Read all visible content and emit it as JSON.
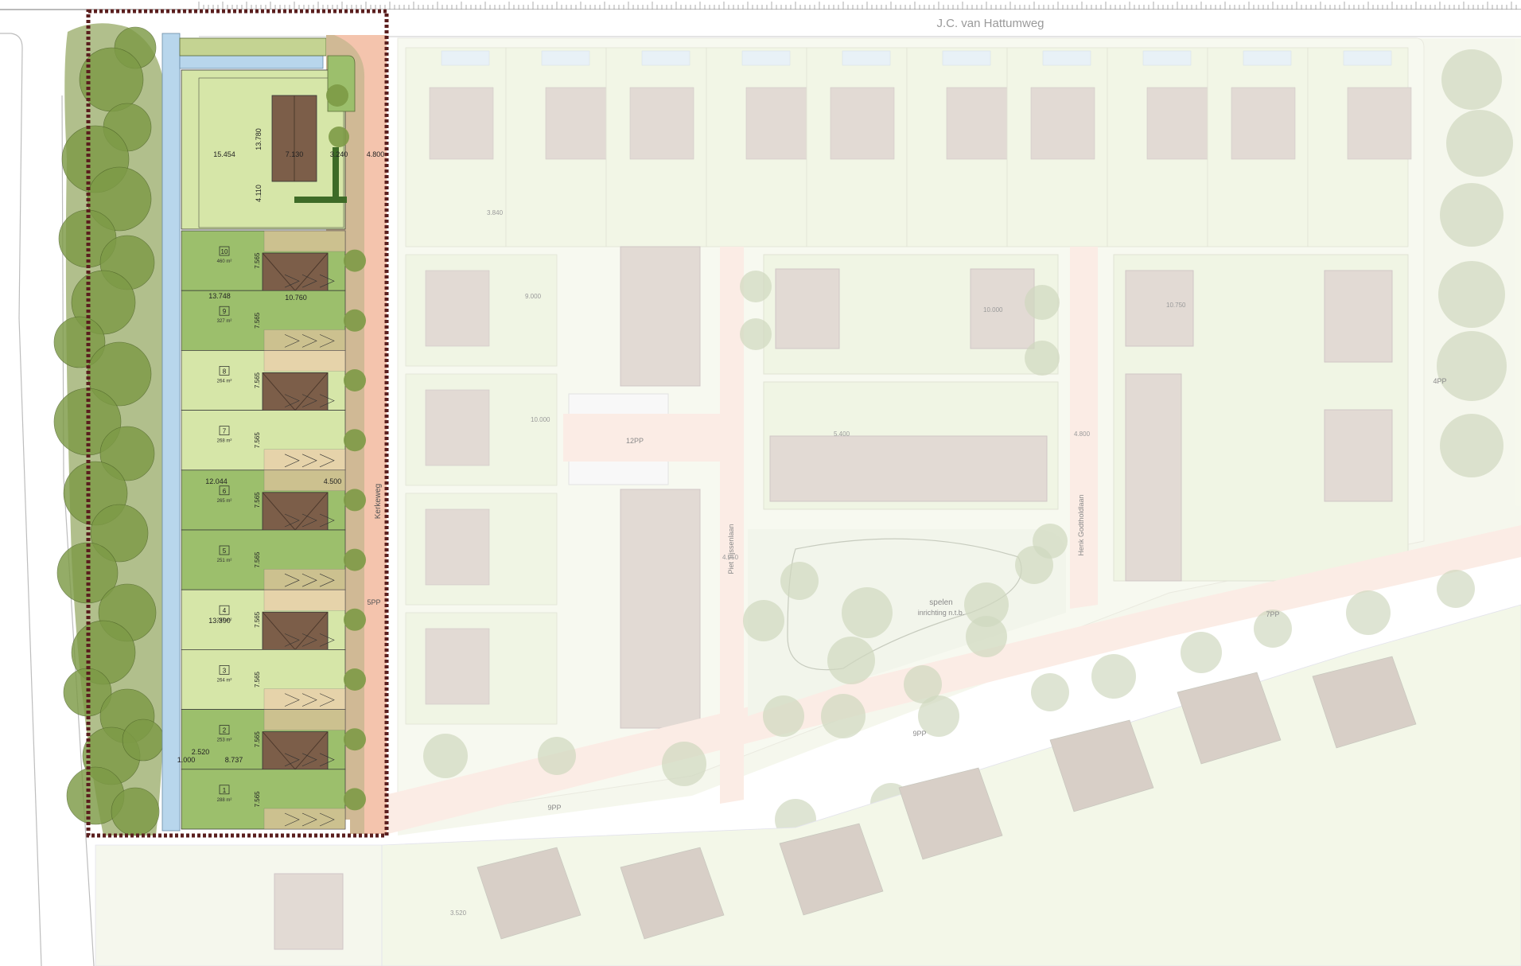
{
  "road_label": "J.C. van Hattumweg",
  "streets": {
    "west_street": "Kerkeweg",
    "piet": "Piet Tijssenlaan",
    "henk": "Henk Godtholdlaan"
  },
  "parking": {
    "p5": "5PP",
    "p12": "12PP",
    "p9a": "9PP",
    "p9b": "9PP",
    "p7": "7PP",
    "p4": "4PP"
  },
  "play_area": {
    "line1": "spelen",
    "line2": "inrichting n.t.b."
  },
  "plots": [
    {
      "num": "10",
      "area": "460 m²",
      "dim": "7.565"
    },
    {
      "num": "9",
      "area": "327 m²",
      "dim": "7.565"
    },
    {
      "num": "8",
      "area": "264 m²",
      "dim": "7.565"
    },
    {
      "num": "7",
      "area": "268 m²",
      "dim": "7.565"
    },
    {
      "num": "6",
      "area": "265 m²",
      "dim": "7.565"
    },
    {
      "num": "5",
      "area": "251 m²",
      "dim": "7.565"
    },
    {
      "num": "4",
      "area": "257 m²",
      "dim": "7.565"
    },
    {
      "num": "3",
      "area": "264 m²",
      "dim": "7.565"
    },
    {
      "num": "2",
      "area": "253 m²",
      "dim": "7.565"
    },
    {
      "num": "1",
      "area": "288 m²",
      "dim": "7.565"
    }
  ],
  "dimensions": {
    "d1": "15.454",
    "d2": "7.130",
    "d3": "3.240",
    "d4": "13.780",
    "d5": "4.110",
    "d6": "13.748",
    "d7": "10.760",
    "d8": "4.800",
    "d9": "12.044",
    "d10": "4.500",
    "d11": "13.390",
    "d12": "8.737",
    "d13": "2.520",
    "d14": "1.000",
    "d15": "3.520",
    "d16": "10.000",
    "d17": "9.000",
    "d18": "5.400",
    "d19": "4.950",
    "d20": "4.800",
    "d21": "3.840",
    "d22": "10.750"
  },
  "colors": {
    "tree": "#7d9a46",
    "water": "#b8d6ec",
    "plot_light": "#d6e6a8",
    "plot_dark": "#9cbf6c",
    "roof": "#7c5e49",
    "paving": "#f4c4ad",
    "boundary": "#5a1e1e"
  }
}
